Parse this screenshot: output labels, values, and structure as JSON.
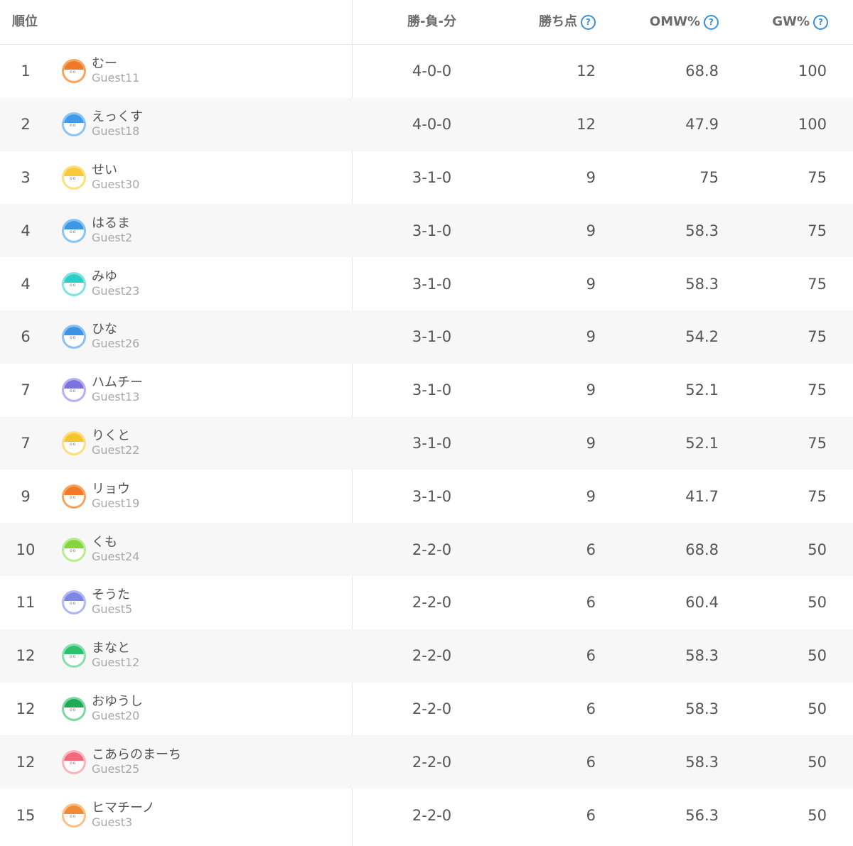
{
  "header": {
    "rank": "順位",
    "record": "勝-負-分",
    "points": "勝ち点",
    "omw": "OMW%",
    "gw": "GW%",
    "help_glyph": "?"
  },
  "rows": [
    {
      "rank": "1",
      "name": "むー",
      "guest": "Guest11",
      "record": "4-0-0",
      "points": "12",
      "omw": "68.8",
      "gw": "100",
      "color": "#f7a45c",
      "hair": "#f07a2a"
    },
    {
      "rank": "2",
      "name": "えっくす",
      "guest": "Guest18",
      "record": "4-0-0",
      "points": "12",
      "omw": "47.9",
      "gw": "100",
      "color": "#8cc5f5",
      "hair": "#3f9ae8"
    },
    {
      "rank": "3",
      "name": "せい",
      "guest": "Guest30",
      "record": "3-1-0",
      "points": "9",
      "omw": "75",
      "gw": "75",
      "color": "#fbe07a",
      "hair": "#f7c83a"
    },
    {
      "rank": "4",
      "name": "はるま",
      "guest": "Guest2",
      "record": "3-1-0",
      "points": "9",
      "omw": "58.3",
      "gw": "75",
      "color": "#8ac4f2",
      "hair": "#3a98e4"
    },
    {
      "rank": "4",
      "name": "みゆ",
      "guest": "Guest23",
      "record": "3-1-0",
      "points": "9",
      "omw": "58.3",
      "gw": "75",
      "color": "#7fe3df",
      "hair": "#2ccfc6"
    },
    {
      "rank": "6",
      "name": "ひな",
      "guest": "Guest26",
      "record": "3-1-0",
      "points": "9",
      "omw": "54.2",
      "gw": "75",
      "color": "#8ebff2",
      "hair": "#3d92e4"
    },
    {
      "rank": "7",
      "name": "ハムチー",
      "guest": "Guest13",
      "record": "3-1-0",
      "points": "9",
      "omw": "52.1",
      "gw": "75",
      "color": "#b6b1f0",
      "hair": "#7d73de"
    },
    {
      "rank": "7",
      "name": "りくと",
      "guest": "Guest22",
      "record": "3-1-0",
      "points": "9",
      "omw": "52.1",
      "gw": "75",
      "color": "#fbe07a",
      "hair": "#f5c530"
    },
    {
      "rank": "9",
      "name": "リョウ",
      "guest": "Guest19",
      "record": "3-1-0",
      "points": "9",
      "omw": "41.7",
      "gw": "75",
      "color": "#f7a45c",
      "hair": "#f07a2a"
    },
    {
      "rank": "10",
      "name": "くも",
      "guest": "Guest24",
      "record": "2-2-0",
      "points": "6",
      "omw": "68.8",
      "gw": "50",
      "color": "#b8ec8a",
      "hair": "#85d63e"
    },
    {
      "rank": "11",
      "name": "そうた",
      "guest": "Guest5",
      "record": "2-2-0",
      "points": "6",
      "omw": "60.4",
      "gw": "50",
      "color": "#b2b6f2",
      "hair": "#7e86e4"
    },
    {
      "rank": "12",
      "name": "まなと",
      "guest": "Guest12",
      "record": "2-2-0",
      "points": "6",
      "omw": "58.3",
      "gw": "50",
      "color": "#86e0ad",
      "hair": "#2fc06e"
    },
    {
      "rank": "12",
      "name": "おゆうし",
      "guest": "Guest20",
      "record": "2-2-0",
      "points": "6",
      "omw": "58.3",
      "gw": "50",
      "color": "#7fd8a4",
      "hair": "#1faa58"
    },
    {
      "rank": "12",
      "name": "こあらのまーち",
      "guest": "Guest25",
      "record": "2-2-0",
      "points": "6",
      "omw": "58.3",
      "gw": "50",
      "color": "#f8b5bc",
      "hair": "#f06b7a"
    },
    {
      "rank": "15",
      "name": "ヒマチーノ",
      "guest": "Guest3",
      "record": "2-2-0",
      "points": "6",
      "omw": "56.3",
      "gw": "50",
      "color": "#f9c08a",
      "hair": "#f08a34"
    }
  ]
}
